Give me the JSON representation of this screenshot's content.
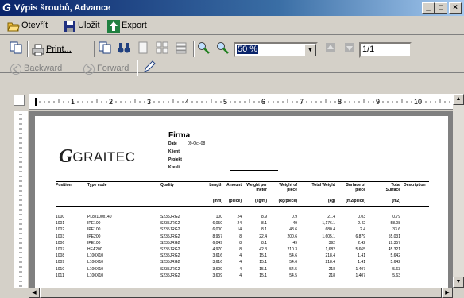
{
  "window": {
    "title": "Výpis šroubů, Advance",
    "minimize": "_",
    "maximize": "□",
    "close": "×"
  },
  "menubar": {
    "open": "Otevřít",
    "save": "Uložit",
    "export": "Export"
  },
  "toolbar": {
    "print": "Print...",
    "zoom": "50 %",
    "page": "1/1",
    "backward": "Backward",
    "forward": "Forward"
  },
  "ruler": {
    "ticks": [
      "1",
      "2",
      "3",
      "4",
      "5",
      "6",
      "7",
      "8",
      "9",
      "10"
    ]
  },
  "report": {
    "company": "Firma",
    "date_label": "Date",
    "date_value": "09-Oct-08",
    "client_label": "Klient",
    "project_label": "Projekt",
    "creator_label": "Kreslil",
    "logo_text": "GRAITEC",
    "headers": [
      "Position",
      "Type code",
      "Quality",
      "Length",
      "Amount",
      "Weight per meter",
      "Weight of piece",
      "Total Weight",
      "Surface of piece",
      "Total Surface",
      "Description"
    ],
    "units": [
      "",
      "",
      "",
      "(mm)",
      "(piece)",
      "(kg/m)",
      "(kg/piece)",
      "(kg)",
      "(m2/piece)",
      "(m2)",
      ""
    ],
    "rows": [
      [
        "1000",
        "PL8x100x140",
        "S235JRG2",
        "100",
        "24",
        "8.9",
        "0.9",
        "21.4",
        "0.03",
        "0.79",
        ""
      ],
      [
        "1001",
        "IPE100",
        "S235JRG2",
        "6,050",
        "24",
        "8.1",
        "49",
        "1,176.1",
        "2.42",
        "58.08",
        ""
      ],
      [
        "1002",
        "IPE100",
        "S235JRG2",
        "6,000",
        "14",
        "8.1",
        "48.6",
        "680.4",
        "2.4",
        "33.6",
        ""
      ],
      [
        "1003",
        "IPE200",
        "S235JRG2",
        "8,957",
        "8",
        "22.4",
        "200.6",
        "1,605.1",
        "6.879",
        "55.031",
        ""
      ],
      [
        "1006",
        "IPE100",
        "S235JRG2",
        "6,049",
        "8",
        "8.1",
        "49",
        "392",
        "2.42",
        "19.357",
        ""
      ],
      [
        "1007",
        "HEA200",
        "S235JRG2",
        "4,970",
        "8",
        "42.3",
        "210.3",
        "1,682",
        "5.665",
        "45.321",
        ""
      ],
      [
        "1008",
        "L100X10",
        "S235JRG2",
        "3,616",
        "4",
        "15.1",
        "54.6",
        "218.4",
        "1.41",
        "5.642",
        ""
      ],
      [
        "1009",
        "L100X10",
        "S235JRG2",
        "3,616",
        "4",
        "15.1",
        "54.6",
        "218.4",
        "1.41",
        "5.642",
        ""
      ],
      [
        "1010",
        "L100X10",
        "S235JRG2",
        "3,609",
        "4",
        "15.1",
        "54.5",
        "218",
        "1.407",
        "5.63",
        ""
      ],
      [
        "1011",
        "L100X10",
        "S235JRG2",
        "3,609",
        "4",
        "15.1",
        "54.5",
        "218",
        "1.407",
        "5.63",
        ""
      ]
    ]
  }
}
